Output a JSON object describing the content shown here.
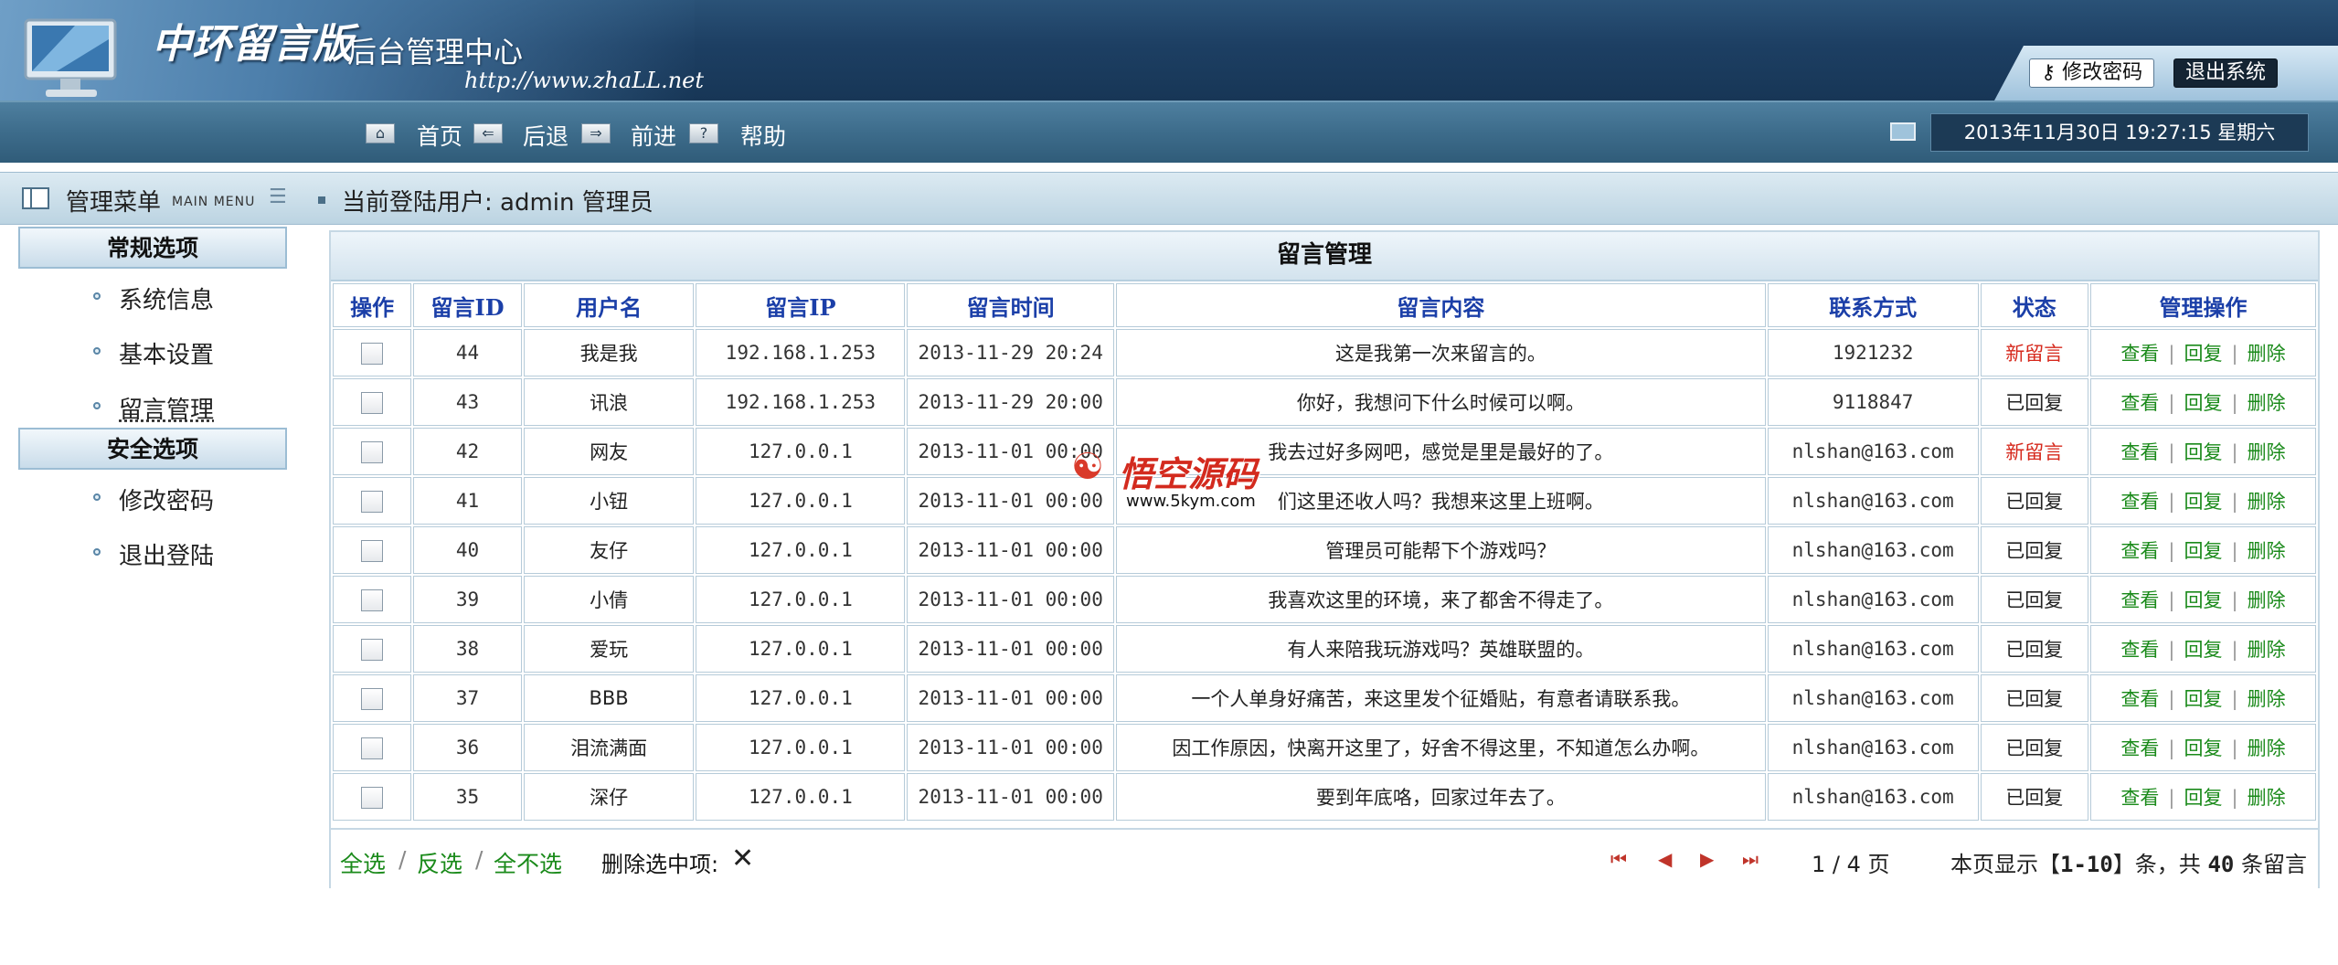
{
  "header": {
    "logo_title": "中环留言版",
    "logo_subtitle": "后台管理中心",
    "logo_url": "http://www.zhaLL.net",
    "change_password": "修改密码",
    "logout": "退出系统"
  },
  "nav": {
    "home": "首页",
    "back": "后退",
    "forward": "前进",
    "help": "帮助",
    "datetime": "2013年11月30日 19:27:15 星期六"
  },
  "userbar": {
    "menu_title": "管理菜单",
    "menu_en": "MAIN MENU",
    "current_user": "当前登陆用户: admin 管理员"
  },
  "sidebar": {
    "groups": [
      {
        "title": "常规选项",
        "items": [
          "系统信息",
          "基本设置",
          "留言管理"
        ]
      },
      {
        "title": "安全选项",
        "items": [
          "修改密码",
          "退出登陆"
        ]
      }
    ]
  },
  "panel": {
    "title": "留言管理"
  },
  "table": {
    "headers": [
      "操作",
      "留言ID",
      "用户名",
      "留言IP",
      "留言时间",
      "留言内容",
      "联系方式",
      "状态",
      "管理操作"
    ],
    "actions": {
      "view": "查看",
      "reply": "回复",
      "delete": "删除"
    },
    "rows": [
      {
        "id": "44",
        "user": "我是我",
        "ip": "192.168.1.253",
        "time": "2013-11-29 20:24",
        "content": "这是我第一次来留言的。",
        "contact": "1921232",
        "status": "新留言",
        "status_type": "new"
      },
      {
        "id": "43",
        "user": "讯浪",
        "ip": "192.168.1.253",
        "time": "2013-11-29 20:00",
        "content": "你好，我想问下什么时候可以啊。",
        "contact": "9118847",
        "status": "已回复",
        "status_type": "done"
      },
      {
        "id": "42",
        "user": "网友",
        "ip": "127.0.0.1",
        "time": "2013-11-01 00:00",
        "content": "我去过好多网吧，感觉是里是最好的了。",
        "contact": "nlshan@163.com",
        "status": "新留言",
        "status_type": "new"
      },
      {
        "id": "41",
        "user": "小钮",
        "ip": "127.0.0.1",
        "time": "2013-11-01 00:00",
        "content": "们这里还收人吗？我想来这里上班啊。",
        "contact": "nlshan@163.com",
        "status": "已回复",
        "status_type": "done"
      },
      {
        "id": "40",
        "user": "友仔",
        "ip": "127.0.0.1",
        "time": "2013-11-01 00:00",
        "content": "管理员可能帮下个游戏吗？",
        "contact": "nlshan@163.com",
        "status": "已回复",
        "status_type": "done"
      },
      {
        "id": "39",
        "user": "小倩",
        "ip": "127.0.0.1",
        "time": "2013-11-01 00:00",
        "content": "我喜欢这里的环境，来了都舍不得走了。",
        "contact": "nlshan@163.com",
        "status": "已回复",
        "status_type": "done"
      },
      {
        "id": "38",
        "user": "爱玩",
        "ip": "127.0.0.1",
        "time": "2013-11-01 00:00",
        "content": "有人来陪我玩游戏吗？英雄联盟的。",
        "contact": "nlshan@163.com",
        "status": "已回复",
        "status_type": "done"
      },
      {
        "id": "37",
        "user": "BBB",
        "ip": "127.0.0.1",
        "time": "2013-11-01 00:00",
        "content": "一个人单身好痛苦，来这里发个征婚贴，有意者请联系我。",
        "contact": "nlshan@163.com",
        "status": "已回复",
        "status_type": "done"
      },
      {
        "id": "36",
        "user": "泪流满面",
        "ip": "127.0.0.1",
        "time": "2013-11-01 00:00",
        "content": "因工作原因，快离开这里了，好舍不得这里，不知道怎么办啊。",
        "contact": "nlshan@163.com",
        "status": "已回复",
        "status_type": "done"
      },
      {
        "id": "35",
        "user": "深仔",
        "ip": "127.0.0.1",
        "time": "2013-11-01 00:00",
        "content": "要到年底咯，回家过年去了。",
        "contact": "nlshan@163.com",
        "status": "已回复",
        "status_type": "done"
      }
    ]
  },
  "pager": {
    "select_all": "全选",
    "invert": "反选",
    "select_none": "全不选",
    "delete_selected": "删除选中项:",
    "page_info": "1 / 4 页",
    "summary_prefix": "本页显示【",
    "summary_range": "1-10",
    "summary_mid": "】条，共 ",
    "summary_total": "40",
    "summary_suffix": " 条留言"
  },
  "watermark": {
    "text": "悟空源码",
    "url": "www.5kym.com"
  },
  "colors": {
    "header_bg": "#1d3f63",
    "navbar_bg": "#3d6c8b",
    "header_text": "#1b3fa8",
    "status_new": "#d6281c",
    "link_green": "#1a8a1a"
  }
}
